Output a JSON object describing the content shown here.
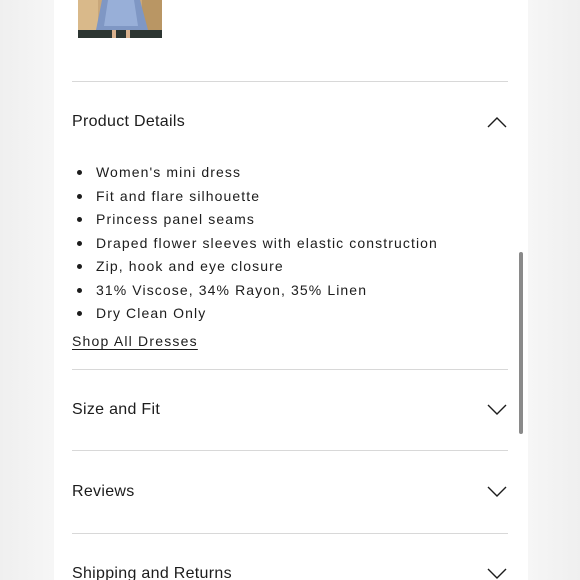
{
  "sections": {
    "product_details": {
      "title": "Product Details",
      "expanded": true,
      "icon": "chevron-up-icon",
      "bullets": [
        "Women's mini dress",
        "Fit and flare silhouette",
        "Princess panel seams",
        "Draped flower sleeves with elastic construction",
        "Zip, hook and eye closure",
        "31% Viscose, 34% Rayon, 35% Linen",
        "Dry Clean Only"
      ],
      "link": "Shop All Dresses"
    },
    "size_and_fit": {
      "title": "Size and Fit",
      "expanded": false,
      "icon": "chevron-down-icon"
    },
    "reviews": {
      "title": "Reviews",
      "expanded": false,
      "icon": "chevron-down-icon"
    },
    "shipping": {
      "title": "Shipping and Returns",
      "expanded": false,
      "icon": "chevron-down-icon"
    }
  },
  "colors": {
    "text": "#1c1c1c",
    "divider": "#d8d8d8",
    "background": "#ffffff"
  }
}
